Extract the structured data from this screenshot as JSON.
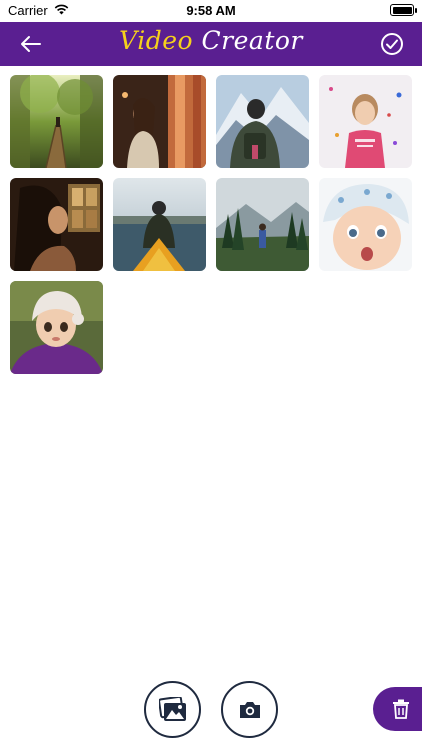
{
  "status_bar": {
    "carrier": "Carrier",
    "time": "9:58 AM"
  },
  "header": {
    "title_part1": "Video",
    "title_part2": "Creator",
    "back_icon": "arrow-left-icon",
    "confirm_icon": "check-circle-icon"
  },
  "colors": {
    "header_bg": "#5a1f91",
    "title_accent": "#f6d11c",
    "title_main": "#ffffff",
    "action_border": "#1f2a3f"
  },
  "photos": [
    {
      "subject": "forest bridge"
    },
    {
      "subject": "woman in city lights"
    },
    {
      "subject": "man facing mountains"
    },
    {
      "subject": "girl in pink shirt"
    },
    {
      "subject": "woman by window"
    },
    {
      "subject": "kayak on lake"
    },
    {
      "subject": "man in forest valley"
    },
    {
      "subject": "surprised baby"
    },
    {
      "subject": "child in knit hat"
    }
  ],
  "bottom_actions": {
    "gallery_icon": "image-gallery-icon",
    "camera_icon": "camera-icon",
    "delete_icon": "trash-icon"
  }
}
